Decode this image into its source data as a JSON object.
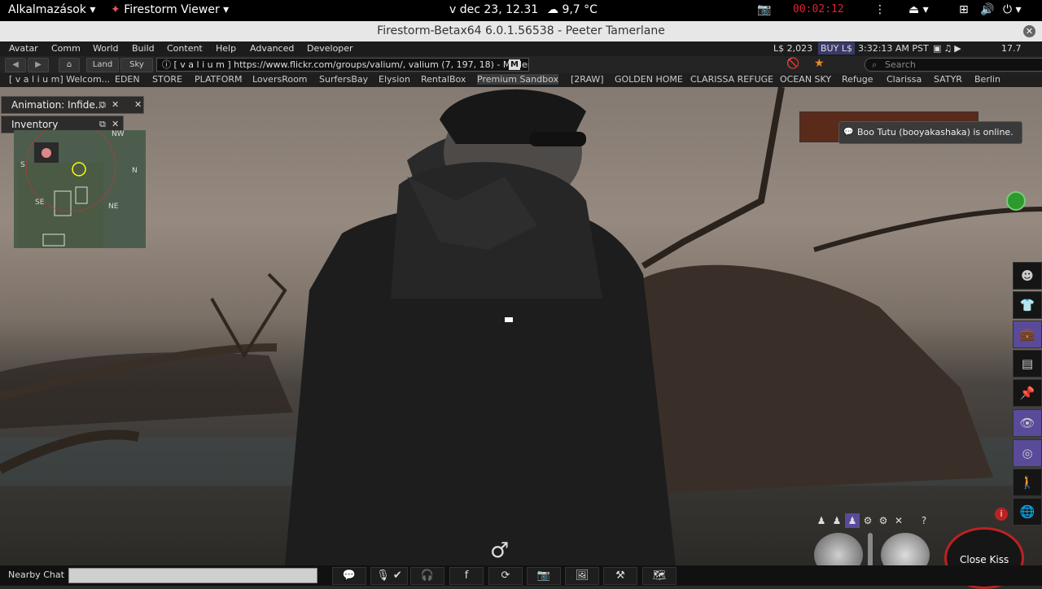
{
  "gnome_bar": {
    "apps_label": "Alkalmazások",
    "app_name": "Firestorm Viewer",
    "clock": "v dec 23, 12.31",
    "weather": "9,7 °C",
    "recording": "00:02:12"
  },
  "window": {
    "title": "Firestorm-Betax64 6.0.1.56538 - Peeter Tamerlane"
  },
  "menu": {
    "items": [
      "Avatar",
      "Comm",
      "World",
      "Build",
      "Content",
      "Help",
      "Advanced",
      "Developer"
    ],
    "balance": "L$ 2,023",
    "buy": "BUY L$",
    "time": "3:32:13 AM PST",
    "fps": "17.7"
  },
  "nav": {
    "land": "Land",
    "sky": "Sky",
    "url": "[ v a l i u m ]  https://www.flickr.com/groups/valium/, valium (7, 197, 18) - Moderate",
    "maturity_badge": "M",
    "search_placeholder": "Search"
  },
  "favorites": [
    "[ v a l i u m] Welcom...",
    "EDEN",
    "STORE",
    "PLATFORM",
    "LoversRoom",
    "SurfersBay",
    "Elysion",
    "RentalBox",
    "Premium Sandbox",
    "[2RAW]",
    "GOLDEN HOME",
    "CLARISSA REFUGE",
    "OCEAN SKY",
    "Refuge",
    "Clarissa",
    "SATYR",
    "Berlin"
  ],
  "panels": {
    "animation": "Animation: Infide...",
    "inventory": "Inventory"
  },
  "minimap": {
    "nw": "NW",
    "n": "N",
    "ne": "NE",
    "se": "SE",
    "s": "S"
  },
  "notification": {
    "text": "Boo Tutu (booyakashaka) is online."
  },
  "bottom": {
    "nearby_chat": "Nearby Chat",
    "close_kiss": "Close Kiss",
    "help_q": "?"
  },
  "colors": {
    "rec": "#e0222c",
    "menu_bg": "#1c1c1c",
    "sidebar_active": "#5a4a9a"
  }
}
